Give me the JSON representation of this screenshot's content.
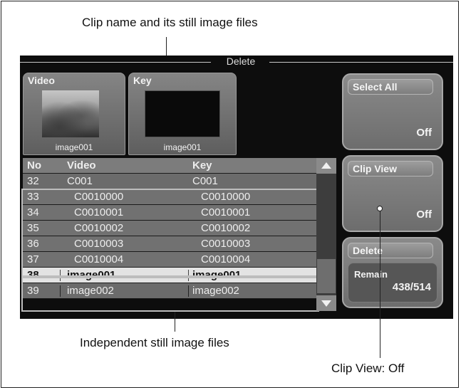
{
  "callouts": {
    "top": "Clip name and its still image files",
    "bottom": "Independent still image files",
    "right": "Clip View: Off"
  },
  "screen": {
    "title": "Delete",
    "video_panel": {
      "label": "Video",
      "caption": "image001"
    },
    "key_panel": {
      "label": "Key",
      "caption": "image001"
    },
    "table": {
      "headers": [
        "No",
        "Video",
        "Key"
      ],
      "rows": [
        [
          "32",
          "C001",
          "C001"
        ],
        [
          "33",
          "C0010000",
          "C0010000"
        ],
        [
          "34",
          "C0010001",
          "C0010001"
        ],
        [
          "35",
          "C0010002",
          "C0010002"
        ],
        [
          "36",
          "C0010003",
          "C0010003"
        ],
        [
          "37",
          "C0010004",
          "C0010004"
        ],
        [
          "38",
          "image001",
          "image001"
        ],
        [
          "39",
          "image002",
          "image002"
        ]
      ],
      "selected_row": "38"
    },
    "buttons": {
      "select_all": {
        "label": "Select All",
        "value": "Off"
      },
      "clip_view": {
        "label": "Clip View",
        "value": "Off"
      },
      "delete": {
        "label": "Delete",
        "remain_label": "Remain",
        "remain_value": "438/514"
      }
    }
  },
  "colors": {
    "screen_bg": "#0d0d0d",
    "row": "#6b6b6b",
    "selected_row": "#e3e3e3",
    "button": "#7a7a7a"
  }
}
